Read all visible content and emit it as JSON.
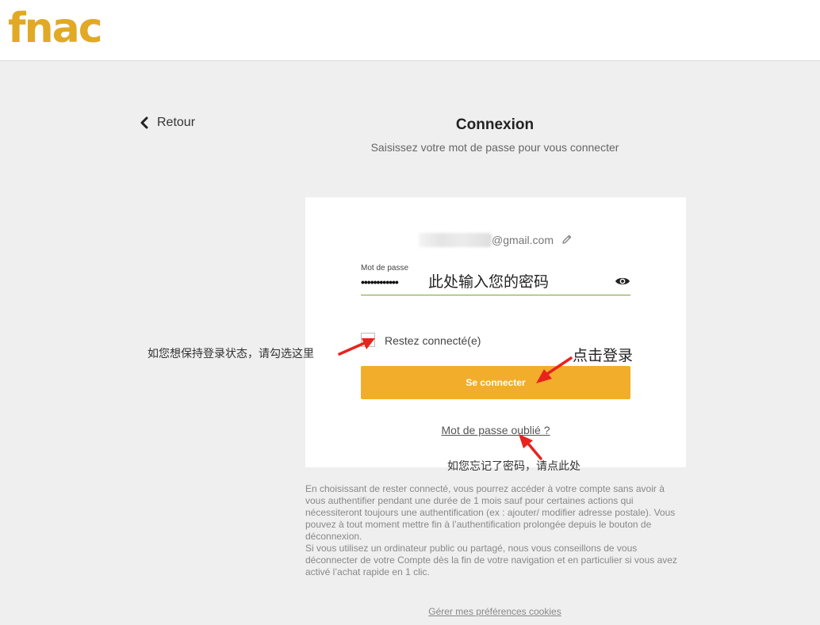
{
  "header": {
    "logo_text": "fnac",
    "logo_color": "#e1a925"
  },
  "nav": {
    "back_label": "Retour"
  },
  "page": {
    "title": "Connexion",
    "subtitle": "Saisissez votre mot de passe pour vous connecter"
  },
  "login": {
    "email_suffix": "@gmail.com",
    "password_label": "Mot de passe",
    "password_value": "••••••••••••",
    "remember_label": "Restez connecté(e)",
    "remember_checked": false,
    "submit_label": "Se connecter",
    "forgot_label": "Mot de passe oublié ?"
  },
  "info": {
    "paragraph1": "En choisissant de rester connecté, vous pourrez accéder à votre compte sans avoir à vous authentifier pendant une durée de 1 mois sauf pour certaines actions qui nécessiteront toujours une authentification (ex : ajouter/ modifier adresse postale). Vous pouvez à tout moment mettre fin à l’authentification prolongée depuis le bouton de déconnexion.",
    "paragraph2": "Si vous utilisez un ordinateur public ou partagé, nous vous conseillons de vous déconnecter de votre Compte dès la fin de votre navigation et en particulier si vous avez activé l’achat rapide en 1 clic."
  },
  "footer": {
    "cookies_label": "Gérer mes préférences cookies"
  },
  "annotations": {
    "password_hint": "此处输入您的密码",
    "remember_hint": "如您想保持登录状态，请勾选这里",
    "login_hint": "点击登录",
    "forgot_hint": "如您忘记了密码，请点此处"
  },
  "colors": {
    "accent": "#f2ae2a",
    "arrow": "#e8231d",
    "input_underline": "#7aa331"
  }
}
